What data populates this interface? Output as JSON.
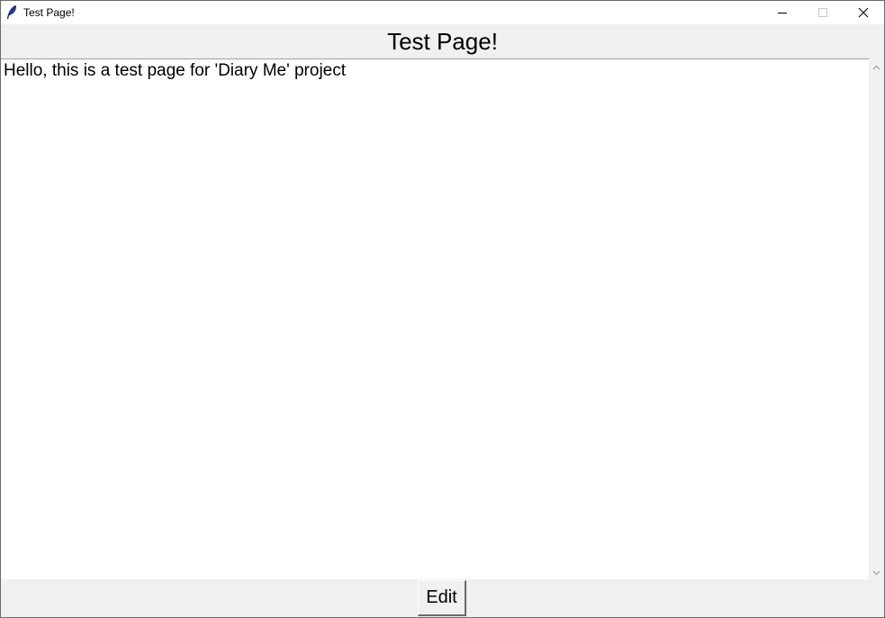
{
  "window": {
    "title": "Test Page!",
    "icon": "feather-icon",
    "controls": {
      "minimize_icon": "minimize-icon",
      "maximize_icon": "maximize-icon",
      "close_icon": "close-icon"
    }
  },
  "header": {
    "title": "Test Page!"
  },
  "editor": {
    "content": "Hello, this is a test page for 'Diary Me' project"
  },
  "footer": {
    "edit_label": "Edit"
  },
  "colors": {
    "window_bg": "#f0f0f0",
    "text_area_bg": "#ffffff",
    "text": "#000000"
  }
}
